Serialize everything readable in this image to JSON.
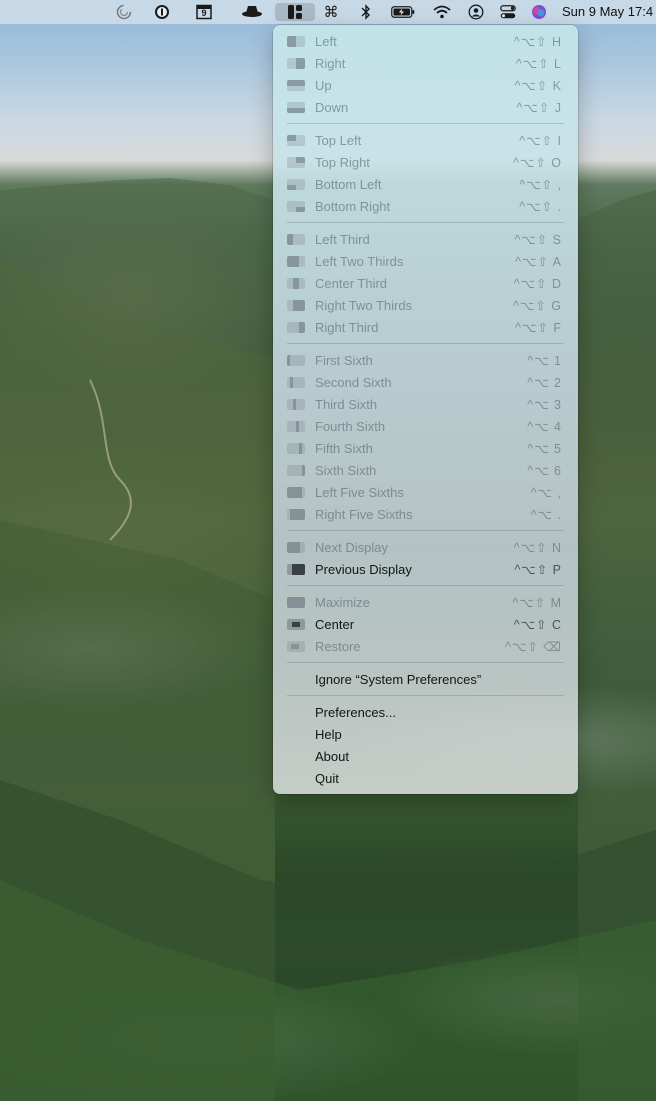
{
  "menubar": {
    "icons": [
      "arc-icon",
      "1password-icon",
      "calendar-icon",
      "incognito-icon",
      "rectangle-app-icon",
      "command-icon",
      "bluetooth-icon",
      "battery-icon",
      "wifi-icon",
      "user-icon",
      "control-center-icon",
      "siri-icon"
    ],
    "calendar_day": "9",
    "clock": "Sun 9 May  17:4"
  },
  "menu": {
    "groups": [
      [
        {
          "label": "Left",
          "shortcut": "^⌥⇧ H",
          "enabled": false,
          "icon": "left-half-icon"
        },
        {
          "label": "Right",
          "shortcut": "^⌥⇧ L",
          "enabled": false,
          "icon": "right-half-icon"
        },
        {
          "label": "Up",
          "shortcut": "^⌥⇧ K",
          "enabled": false,
          "icon": "top-half-icon"
        },
        {
          "label": "Down",
          "shortcut": "^⌥⇧ J",
          "enabled": false,
          "icon": "bottom-half-icon"
        }
      ],
      [
        {
          "label": "Top Left",
          "shortcut": "^⌥⇧ I",
          "enabled": false,
          "icon": "top-left-icon"
        },
        {
          "label": "Top Right",
          "shortcut": "^⌥⇧ O",
          "enabled": false,
          "icon": "top-right-icon"
        },
        {
          "label": "Bottom Left",
          "shortcut": "^⌥⇧ ,",
          "enabled": false,
          "icon": "bottom-left-icon"
        },
        {
          "label": "Bottom Right",
          "shortcut": "^⌥⇧ .",
          "enabled": false,
          "icon": "bottom-right-icon"
        }
      ],
      [
        {
          "label": "Left Third",
          "shortcut": "^⌥⇧ S",
          "enabled": false,
          "icon": "left-third-icon"
        },
        {
          "label": "Left Two Thirds",
          "shortcut": "^⌥⇧ A",
          "enabled": false,
          "icon": "left-two-thirds-icon"
        },
        {
          "label": "Center Third",
          "shortcut": "^⌥⇧ D",
          "enabled": false,
          "icon": "center-third-icon"
        },
        {
          "label": "Right Two Thirds",
          "shortcut": "^⌥⇧ G",
          "enabled": false,
          "icon": "right-two-thirds-icon"
        },
        {
          "label": "Right Third",
          "shortcut": "^⌥⇧ F",
          "enabled": false,
          "icon": "right-third-icon"
        }
      ],
      [
        {
          "label": "First Sixth",
          "shortcut": "^⌥ 1",
          "enabled": false,
          "icon": "first-sixth-icon"
        },
        {
          "label": "Second Sixth",
          "shortcut": "^⌥ 2",
          "enabled": false,
          "icon": "second-sixth-icon"
        },
        {
          "label": "Third Sixth",
          "shortcut": "^⌥ 3",
          "enabled": false,
          "icon": "third-sixth-icon"
        },
        {
          "label": "Fourth Sixth",
          "shortcut": "^⌥ 4",
          "enabled": false,
          "icon": "fourth-sixth-icon"
        },
        {
          "label": "Fifth Sixth",
          "shortcut": "^⌥ 5",
          "enabled": false,
          "icon": "fifth-sixth-icon"
        },
        {
          "label": "Sixth Sixth",
          "shortcut": "^⌥ 6",
          "enabled": false,
          "icon": "sixth-sixth-icon"
        },
        {
          "label": "Left Five Sixths",
          "shortcut": "^⌥ ,",
          "enabled": false,
          "icon": "left-five-sixths-icon"
        },
        {
          "label": "Right Five Sixths",
          "shortcut": "^⌥ .",
          "enabled": false,
          "icon": "right-five-sixths-icon"
        }
      ],
      [
        {
          "label": "Next Display",
          "shortcut": "^⌥⇧ N",
          "enabled": false,
          "icon": "next-display-icon"
        },
        {
          "label": "Previous Display",
          "shortcut": "^⌥⇧ P",
          "enabled": true,
          "icon": "previous-display-icon"
        }
      ],
      [
        {
          "label": "Maximize",
          "shortcut": "^⌥⇧ M",
          "enabled": false,
          "icon": "maximize-icon"
        },
        {
          "label": "Center",
          "shortcut": "^⌥⇧ C",
          "enabled": true,
          "icon": "center-icon"
        },
        {
          "label": "Restore",
          "shortcut": "^⌥⇧ ⌫",
          "enabled": false,
          "icon": "restore-icon"
        }
      ],
      [
        {
          "label": "Ignore “System Preferences”",
          "shortcut": "",
          "enabled": true,
          "icon": ""
        }
      ],
      [
        {
          "label": "Preferences...",
          "shortcut": "",
          "enabled": true,
          "icon": ""
        },
        {
          "label": "Help",
          "shortcut": "",
          "enabled": true,
          "icon": ""
        },
        {
          "label": "About",
          "shortcut": "",
          "enabled": true,
          "icon": ""
        },
        {
          "label": "Quit",
          "shortcut": "",
          "enabled": true,
          "icon": ""
        }
      ]
    ]
  }
}
